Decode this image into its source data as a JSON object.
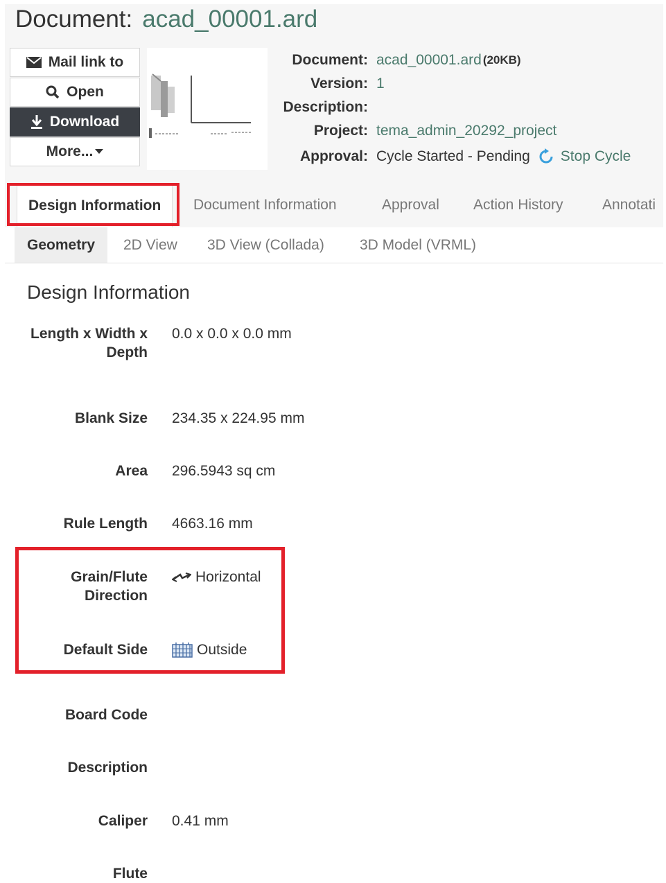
{
  "document_title": {
    "prefix": "Document:",
    "name": "acad_00001.ard"
  },
  "actions": {
    "mail": "Mail link to",
    "open": "Open",
    "download": "Download",
    "more": "More..."
  },
  "meta": {
    "document_label": "Document:",
    "document_value": "acad_00001.ard",
    "document_size": "(20KB)",
    "version_label": "Version:",
    "version_value": "1",
    "description_label": "Description:",
    "project_label": "Project:",
    "project_value": "tema_admin_20292_project",
    "approval_label": "Approval:",
    "approval_value": "Cycle Started - Pending",
    "stop_cycle": "Stop Cycle"
  },
  "tabs": [
    "Design Information",
    "Document Information",
    "Approval",
    "Action History",
    "Annotati"
  ],
  "subtabs": [
    "Geometry",
    "2D View",
    "3D View (Collada)",
    "3D Model (VRML)"
  ],
  "section_title": "Design Information",
  "fields": {
    "lwd_label_1": "Length x Width x",
    "lwd_label_2": "Depth",
    "lwd_value": "0.0 x 0.0 x 0.0  mm",
    "blank_label": "Blank Size",
    "blank_value": "234.35  x  224.95  mm",
    "area_label": "Area",
    "area_value": "296.5943  sq cm",
    "rule_label": "Rule Length",
    "rule_value": "4663.16  mm",
    "grain_label_1": "Grain/Flute",
    "grain_label_2": "Direction",
    "grain_value": "Horizontal",
    "side_label": "Default Side",
    "side_value": "Outside",
    "board_label": "Board Code",
    "desc_label": "Description",
    "caliper_label": "Caliper",
    "caliper_value": "0.41  mm",
    "flute_label": "Flute"
  },
  "colors": {
    "highlight": "#e3202a",
    "link": "#4a7a6c",
    "primary_button": "#3b3f45"
  }
}
